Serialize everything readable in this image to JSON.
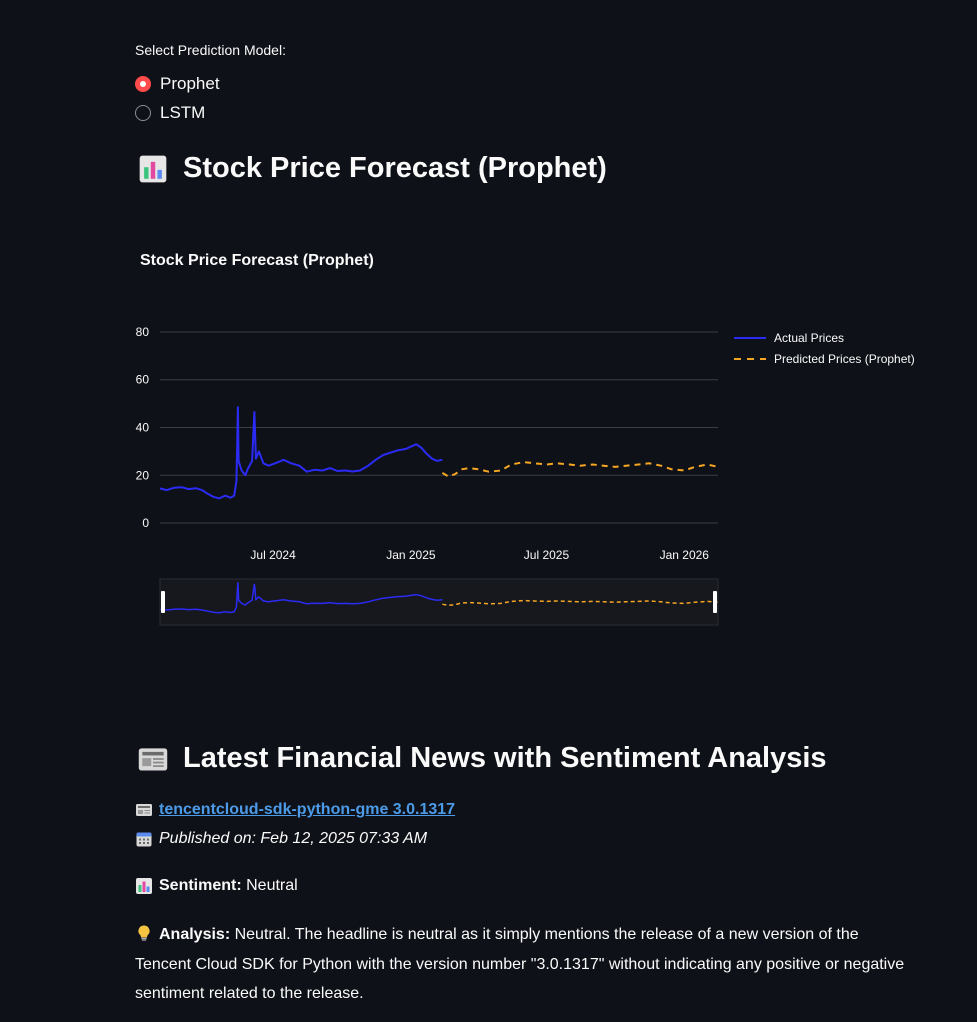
{
  "model_select": {
    "label": "Select Prediction Model:",
    "options": [
      {
        "label": "Prophet",
        "selected": true
      },
      {
        "label": "LSTM",
        "selected": false
      }
    ]
  },
  "forecast_section": {
    "heading": "Stock Price Forecast (Prophet)",
    "heading_icon": "bar-chart-icon"
  },
  "chart_data": {
    "type": "line",
    "title": "Stock Price Forecast (Prophet)",
    "xlabel": "",
    "ylabel": "",
    "ylim": [
      -5,
      85
    ],
    "yticks": [
      0,
      20,
      40,
      60,
      80
    ],
    "xticks": [
      "Jul 2024",
      "Jan 2025",
      "Jul 2025",
      "Jan 2026"
    ],
    "xrange": [
      "2024-02-01",
      "2026-02-15"
    ],
    "legend_position": "top-right",
    "series": [
      {
        "name": "Actual Prices",
        "color": "#2b2bf5",
        "style": "solid",
        "points": [
          [
            "2024-02-01",
            14.5
          ],
          [
            "2024-02-10",
            13.8
          ],
          [
            "2024-02-20",
            14.8
          ],
          [
            "2024-03-01",
            15.0
          ],
          [
            "2024-03-10",
            14.2
          ],
          [
            "2024-03-20",
            14.6
          ],
          [
            "2024-03-28",
            13.8
          ],
          [
            "2024-04-05",
            12.2
          ],
          [
            "2024-04-12",
            11.0
          ],
          [
            "2024-04-20",
            10.3
          ],
          [
            "2024-04-28",
            11.5
          ],
          [
            "2024-05-05",
            10.6
          ],
          [
            "2024-05-10",
            11.5
          ],
          [
            "2024-05-13",
            17.5
          ],
          [
            "2024-05-14",
            30.5
          ],
          [
            "2024-05-15",
            48.5
          ],
          [
            "2024-05-16",
            26.0
          ],
          [
            "2024-05-20",
            22.0
          ],
          [
            "2024-05-25",
            20.0
          ],
          [
            "2024-05-28",
            22.5
          ],
          [
            "2024-06-03",
            26.0
          ],
          [
            "2024-06-06",
            46.5
          ],
          [
            "2024-06-08",
            27.0
          ],
          [
            "2024-06-12",
            30.0
          ],
          [
            "2024-06-18",
            25.0
          ],
          [
            "2024-06-25",
            24.0
          ],
          [
            "2024-07-05",
            25.2
          ],
          [
            "2024-07-15",
            26.5
          ],
          [
            "2024-07-25",
            25.0
          ],
          [
            "2024-08-05",
            24.0
          ],
          [
            "2024-08-15",
            21.5
          ],
          [
            "2024-08-25",
            22.3
          ],
          [
            "2024-09-05",
            22.0
          ],
          [
            "2024-09-15",
            23.0
          ],
          [
            "2024-09-25",
            21.8
          ],
          [
            "2024-10-05",
            22.0
          ],
          [
            "2024-10-15",
            21.6
          ],
          [
            "2024-10-25",
            22.0
          ],
          [
            "2024-11-05",
            24.0
          ],
          [
            "2024-11-15",
            26.5
          ],
          [
            "2024-11-25",
            28.5
          ],
          [
            "2024-12-05",
            29.5
          ],
          [
            "2024-12-15",
            30.5
          ],
          [
            "2024-12-25",
            31.0
          ],
          [
            "2025-01-01",
            32.0
          ],
          [
            "2025-01-08",
            33.0
          ],
          [
            "2025-01-15",
            31.5
          ],
          [
            "2025-01-22",
            29.0
          ],
          [
            "2025-01-29",
            27.0
          ],
          [
            "2025-02-05",
            26.0
          ],
          [
            "2025-02-12",
            26.5
          ]
        ]
      },
      {
        "name": "Predicted Prices (Prophet)",
        "color": "#f5a623",
        "style": "dashed",
        "points": [
          [
            "2025-02-12",
            21.0
          ],
          [
            "2025-02-20",
            19.5
          ],
          [
            "2025-03-01",
            20.5
          ],
          [
            "2025-03-10",
            22.5
          ],
          [
            "2025-03-20",
            23.0
          ],
          [
            "2025-04-01",
            22.5
          ],
          [
            "2025-04-15",
            21.5
          ],
          [
            "2025-05-01",
            22.0
          ],
          [
            "2025-05-15",
            24.5
          ],
          [
            "2025-06-01",
            25.5
          ],
          [
            "2025-06-15",
            25.0
          ],
          [
            "2025-07-01",
            24.5
          ],
          [
            "2025-07-15",
            25.0
          ],
          [
            "2025-08-01",
            24.5
          ],
          [
            "2025-08-15",
            24.0
          ],
          [
            "2025-09-01",
            24.5
          ],
          [
            "2025-09-15",
            24.0
          ],
          [
            "2025-10-01",
            23.5
          ],
          [
            "2025-10-15",
            24.0
          ],
          [
            "2025-11-01",
            24.5
          ],
          [
            "2025-11-15",
            25.0
          ],
          [
            "2025-12-01",
            24.0
          ],
          [
            "2025-12-15",
            22.5
          ],
          [
            "2026-01-01",
            22.0
          ],
          [
            "2026-01-15",
            23.5
          ],
          [
            "2026-02-01",
            24.5
          ],
          [
            "2026-02-15",
            23.5
          ]
        ]
      }
    ],
    "range_slider": {
      "range_start": "2024-02-01",
      "range_end": "2026-02-15",
      "series_colors": [
        "#2b2bf5",
        "#f5a623"
      ]
    }
  },
  "news_section": {
    "heading": "Latest Financial News with Sentiment Analysis",
    "heading_icon": "newspaper-icon",
    "article": {
      "title": "tencentcloud-sdk-python-gme 3.0.1317",
      "published": "Published on: Feb 12, 2025 07:33 AM",
      "sentiment_label": "Sentiment:",
      "sentiment_value": " Neutral",
      "analysis_label": "Analysis:",
      "analysis_text": " Neutral. The headline is neutral as it simply mentions the release of a new version of the Tencent Cloud SDK for Python with the version number \"3.0.1317\" without indicating any positive or negative sentiment related to the release."
    }
  }
}
